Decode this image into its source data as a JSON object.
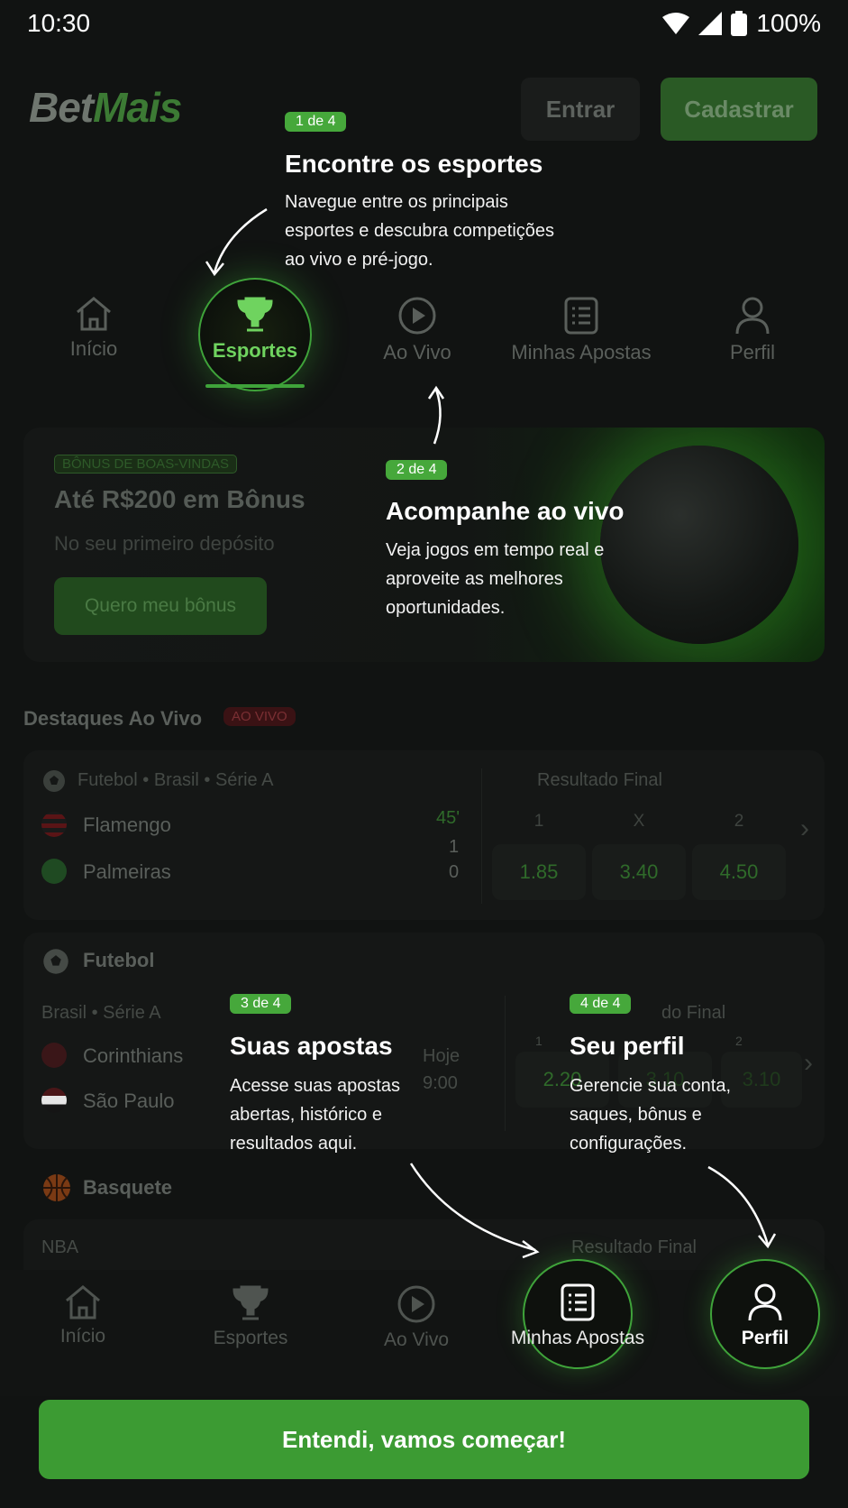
{
  "status": {
    "time": "10:30",
    "battery": "100%"
  },
  "header": {
    "logo_bet": "Bet",
    "logo_mais": "Mais",
    "login": "Entrar",
    "signup": "Cadastrar"
  },
  "topnav": [
    "Início",
    "Esportes",
    "Ao Vivo",
    "Minhas Apostas",
    "Perfil"
  ],
  "promo": {
    "badge": "BÔNUS DE BOAS-VINDAS",
    "title": "Até R$200 em Bônus",
    "subtitle": "No seu primeiro depósito",
    "cta": "Quero meu bônus"
  },
  "live": {
    "title": "Destaques Ao Vivo",
    "badge": "AO VIVO",
    "match": {
      "league": "Futebol • Brasil • Série A",
      "market": "Resultado Final",
      "minute": "45'",
      "home": "Flamengo",
      "home_score": "1",
      "away": "Palmeiras",
      "away_score": "0",
      "labels": [
        "1",
        "X",
        "2"
      ],
      "odds": [
        "1.85",
        "3.40",
        "4.50"
      ]
    }
  },
  "football": {
    "title": "Futebol",
    "league": "Brasil • Série A",
    "market_partial": "do Final",
    "home": "Corinthians",
    "away": "São Paulo",
    "day": "Hoje",
    "time": "9:00",
    "label1": "1",
    "label2": "2",
    "odd1": "2.20",
    "odd2": "3.10",
    "odd3": "3.10"
  },
  "basket": {
    "title": "Basquete",
    "league": "NBA",
    "market": "Resultado Final"
  },
  "bottomnav": [
    "Início",
    "Esportes",
    "Ao Vivo",
    "Minhas Apostas",
    "Perfil"
  ],
  "coach": [
    {
      "step": "1 de 4",
      "title": "Encontre os esportes",
      "lines": [
        "Navegue entre os principais",
        "esportes e descubra competições",
        "ao vivo e pré-jogo."
      ]
    },
    {
      "step": "2 de 4",
      "title": "Acompanhe ao vivo",
      "lines": [
        "Veja jogos em tempo real e",
        "aproveite as melhores",
        "oportunidades."
      ]
    },
    {
      "step": "3 de 4",
      "title": "Suas apostas",
      "lines": [
        "Acesse suas apostas",
        "abertas, histórico e",
        "resultados aqui."
      ]
    },
    {
      "step": "4 de 4",
      "title": "Seu perfil",
      "lines": [
        "Gerencie sua conta,",
        "saques, bônus e",
        "configurações."
      ]
    }
  ],
  "cta": "Entendi, vamos começar!",
  "colors": {
    "accent": "#46a83b",
    "background": "#111312",
    "live_red": "#7a2f33"
  }
}
